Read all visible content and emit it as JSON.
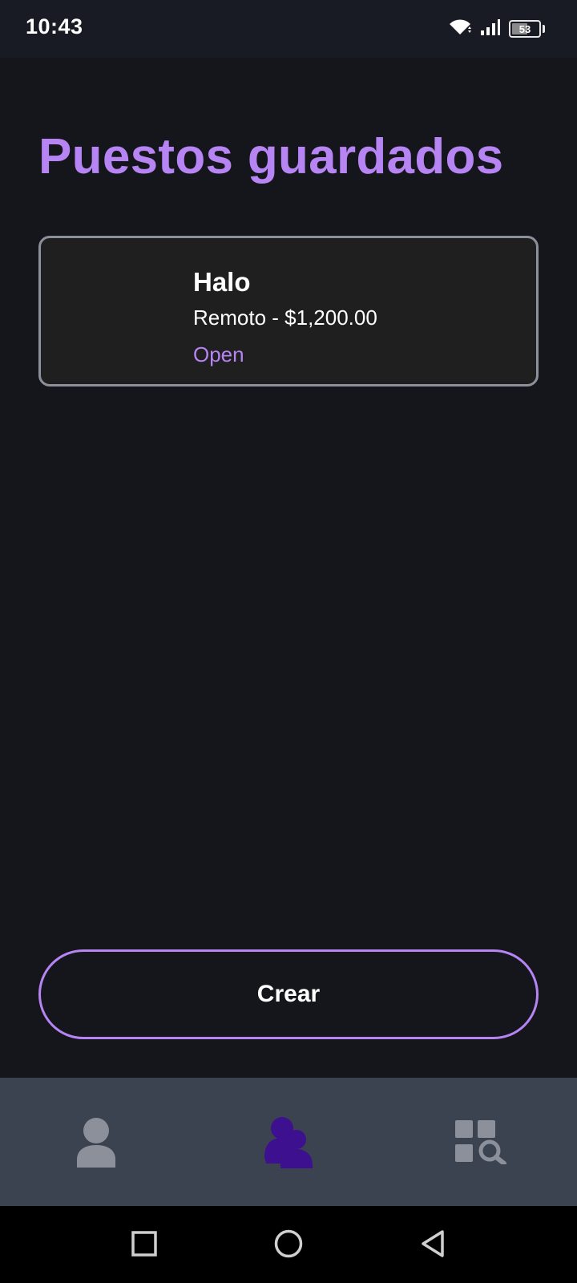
{
  "status_bar": {
    "time": "10:43",
    "battery_level": "53",
    "icons": [
      "wifi-icon",
      "signal-icon",
      "battery-icon"
    ]
  },
  "page": {
    "title": "Puestos guardados"
  },
  "jobs": [
    {
      "title": "Halo",
      "subtitle": "Remoto - $1,200.00",
      "status": "Open"
    }
  ],
  "create_button": {
    "label": "Crear"
  },
  "bottom_nav": {
    "items": [
      {
        "icon": "profile-icon",
        "active": false
      },
      {
        "icon": "people-icon",
        "active": true
      },
      {
        "icon": "search-grid-icon",
        "active": false
      }
    ]
  },
  "system_nav": {
    "items": [
      "recents-icon",
      "home-icon",
      "back-icon"
    ]
  },
  "colors": {
    "background": "#14161c",
    "accent": "#b784f3",
    "card_background": "#1f1f1f",
    "card_border": "#8b909a",
    "nav_background": "#3c4350",
    "nav_active": "#3d1090",
    "nav_inactive": "#8b909a"
  }
}
